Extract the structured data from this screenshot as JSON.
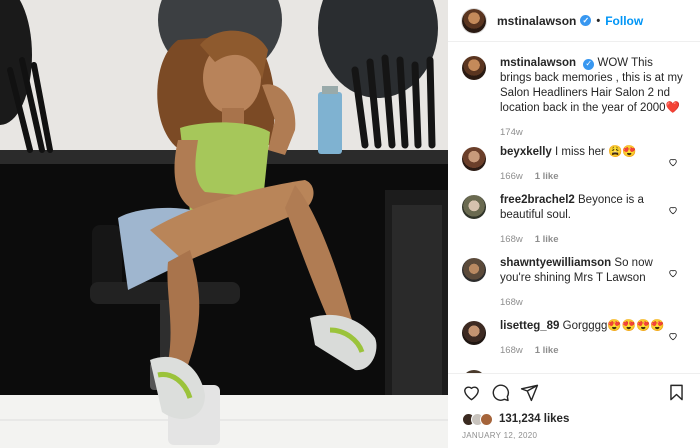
{
  "post": {
    "image_alt": "Woman sitting on a salon chair in a hair salon",
    "author": "mstinalawson",
    "follow_label": "Follow",
    "separator": "•"
  },
  "caption": {
    "username": "mstinalawson",
    "text": "WOW This brings back memories , this is at my Salon Headliners Hair Salon 2 nd location back in the year of 2000❤️",
    "time": "174w"
  },
  "comments": [
    {
      "username": "beyxkelly",
      "text": "I miss her 😩😍",
      "time": "166w",
      "likes": "1 like"
    },
    {
      "username": "free2brachel2",
      "text": "Beyonce is a beautiful soul.",
      "time": "168w",
      "likes": "1 like"
    },
    {
      "username": "shawntyewilliamson",
      "text": "So now you're shining Mrs T Lawson",
      "time": "168w",
      "likes": ""
    },
    {
      "username": "lisetteg_89",
      "text": "Gorgggg😍😍😍😍",
      "time": "168w",
      "likes": "1 like"
    },
    {
      "username": "",
      "text": "",
      "time": "",
      "likes": ""
    }
  ],
  "stats": {
    "likes_count": "131,234 likes",
    "date": "JANUARY 12, 2020"
  },
  "colors": {
    "accent": "#0095f6",
    "verified": "#3897f0",
    "muted": "#8e8e8e",
    "text": "#262626"
  },
  "icons": {
    "like": "heart-icon",
    "comment": "comment-icon",
    "share": "paper-plane-icon",
    "save": "bookmark-icon",
    "verified": "verified-badge-icon"
  }
}
